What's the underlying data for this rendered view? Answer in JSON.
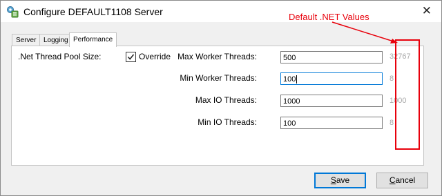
{
  "window": {
    "title": "Configure DEFAULT1108 Server",
    "close_glyph": "✕"
  },
  "tabs": [
    {
      "label": "Server",
      "active": false
    },
    {
      "label": "Logging",
      "active": false
    },
    {
      "label": "Performance",
      "active": true
    }
  ],
  "performance": {
    "pool_label": ".Net Thread Pool Size:",
    "override_label": "Override",
    "override_checked": true,
    "rows": [
      {
        "label": "Max Worker Threads:",
        "value": "500",
        "default": "32767"
      },
      {
        "label": "Min Worker Threads:",
        "value": "100",
        "default": "8"
      },
      {
        "label": "Max IO Threads:",
        "value": "1000",
        "default": "1000"
      },
      {
        "label": "Min IO Threads:",
        "value": "100",
        "default": "8"
      }
    ]
  },
  "buttons": {
    "save": {
      "mnemonic": "S",
      "rest": "ave"
    },
    "cancel": {
      "mnemonic": "C",
      "rest": "ancel"
    }
  },
  "annotation": {
    "text": "Default .NET Values",
    "color": "#e8000b"
  },
  "icons": {
    "app": "server-config-icon",
    "close": "close-icon",
    "check": "checkmark-icon"
  },
  "colors": {
    "focus_border": "#0078d7",
    "default_value_text": "#a8a8a8",
    "dialog_bg": "#f0f0f0"
  }
}
